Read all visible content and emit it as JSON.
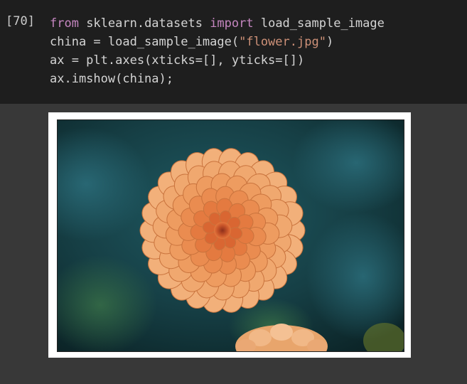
{
  "cell": {
    "prompt": "[70]",
    "lines": [
      [
        {
          "t": "from",
          "c": "kw"
        },
        {
          "t": " sklearn.datasets ",
          "c": ""
        },
        {
          "t": "import",
          "c": "kw"
        },
        {
          "t": " load_sample_image",
          "c": ""
        }
      ],
      [
        {
          "t": "china = load_sample_image(",
          "c": ""
        },
        {
          "t": "\"flower.jpg\"",
          "c": "str"
        },
        {
          "t": ")",
          "c": ""
        }
      ],
      [
        {
          "t": "ax = plt.axes(xticks=[], yticks=[])",
          "c": ""
        }
      ],
      [
        {
          "t": "ax.imshow(china);",
          "c": ""
        }
      ]
    ]
  },
  "output": {
    "image_subject": "flower-photo",
    "colors": {
      "background_dark": "#0d2a2e",
      "background_teal": "#1c5560",
      "petal_outer": "#f2b07a",
      "petal_inner": "#e8843e",
      "center": "#c8552a"
    }
  }
}
